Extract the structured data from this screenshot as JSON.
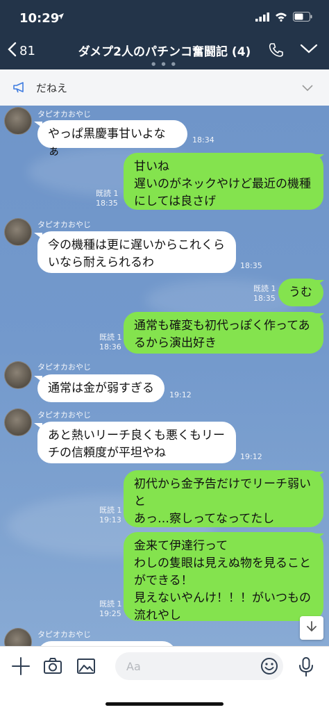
{
  "status": {
    "time": "10:29",
    "location_icon": "location-arrow-icon"
  },
  "header": {
    "back_count": "81",
    "title": "ダメプ2人のパチンコ奮闘記 (4)",
    "page_dots": "● ● ●"
  },
  "announcement": {
    "text": "だねえ"
  },
  "colors": {
    "header_bg": "#233449",
    "my_bubble": "#84e34e",
    "their_bubble": "#ffffff",
    "chat_bg": "#7399cc"
  },
  "messages": [
    {
      "sender": "タピオカおやじ",
      "text": "やっぱ黒慶事甘いよなぁ",
      "time": "18:34"
    },
    {
      "read": "既読 1",
      "text": "甘いね\n遅いのがネックやけど最近の機種\nにしては良さげ",
      "time": "18:35"
    },
    {
      "sender": "タピオカおやじ",
      "text": "今の機種は更に遅いからこれくら\nいなら耐えられるわ",
      "time": "18:35"
    },
    {
      "read": "既読 1",
      "text": "うむ",
      "time": "18:35"
    },
    {
      "read": "既読 1",
      "text": "通常も確変も初代っぽく作ってあ\nるから演出好き",
      "time": "18:36"
    },
    {
      "sender": "タピオカおやじ",
      "text": "通常は金が弱すぎる",
      "time": "19:12"
    },
    {
      "sender": "タピオカおやじ",
      "text": "あと熱いリーチ良くも悪くもリー\nチの信頼度が平坦やね",
      "time": "19:12"
    },
    {
      "read": "既読 1",
      "text": "初代から金予告だけでリーチ弱い\nと\nあっ…察しってなってたし",
      "time": "19:13"
    },
    {
      "read": "既読 1",
      "text": "金来て伊達行って\nわしの隻眼は見えぬ物を見ること\nができる！\n見えないやんけ！！！がいつもの\n流れやし",
      "time": "19:25"
    },
    {
      "sender": "タピオカおやじ"
    }
  ],
  "input": {
    "placeholder": "Aa"
  }
}
